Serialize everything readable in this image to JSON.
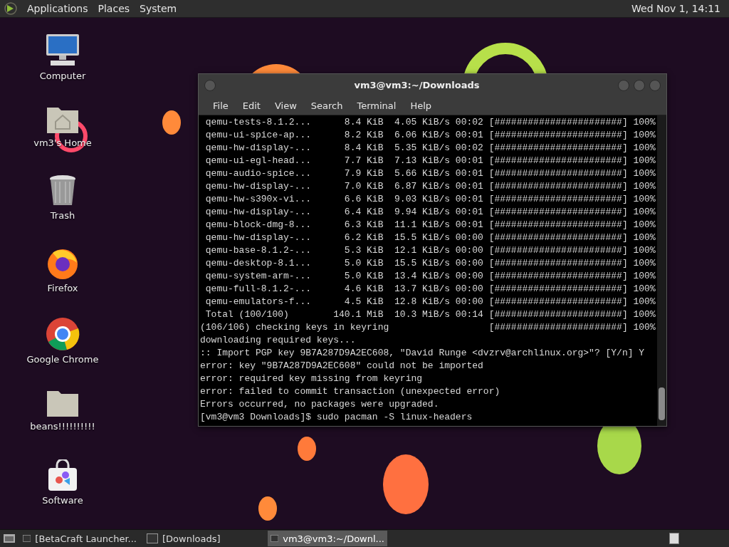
{
  "top_panel": {
    "menus": [
      "Applications",
      "Places",
      "System"
    ],
    "clock": "Wed Nov 1, 14:11"
  },
  "desktop_icons": [
    {
      "label": "Computer"
    },
    {
      "label": "vm3's Home"
    },
    {
      "label": "Trash"
    },
    {
      "label": "Firefox"
    },
    {
      "label": "Google Chrome"
    },
    {
      "label": "beans!!!!!!!!!!"
    },
    {
      "label": "Software"
    }
  ],
  "terminal": {
    "title": "vm3@vm3:~/Downloads",
    "menu": [
      "File",
      "Edit",
      "View",
      "Search",
      "Terminal",
      "Help"
    ],
    "lines": [
      " qemu-tests-8.1.2...      8.4 KiB  4.05 KiB/s 00:02 [#######################] 100%",
      " qemu-ui-spice-ap...      8.2 KiB  6.06 KiB/s 00:01 [#######################] 100%",
      " qemu-hw-display-...      8.4 KiB  5.35 KiB/s 00:02 [#######################] 100%",
      " qemu-ui-egl-head...      7.7 KiB  7.13 KiB/s 00:01 [#######################] 100%",
      " qemu-audio-spice...      7.9 KiB  5.66 KiB/s 00:01 [#######################] 100%",
      " qemu-hw-display-...      7.0 KiB  6.87 KiB/s 00:01 [#######################] 100%",
      " qemu-hw-s390x-vi...      6.6 KiB  9.03 KiB/s 00:01 [#######################] 100%",
      " qemu-hw-display-...      6.4 KiB  9.94 KiB/s 00:01 [#######################] 100%",
      " qemu-block-dmg-8...      6.3 KiB  11.1 KiB/s 00:01 [#######################] 100%",
      " qemu-hw-display-...      6.2 KiB  15.5 KiB/s 00:00 [#######################] 100%",
      " qemu-base-8.1.2-...      5.3 KiB  12.1 KiB/s 00:00 [#######################] 100%",
      " qemu-desktop-8.1...      5.0 KiB  15.5 KiB/s 00:00 [#######################] 100%",
      " qemu-system-arm-...      5.0 KiB  13.4 KiB/s 00:00 [#######################] 100%",
      " qemu-full-8.1.2-...      4.6 KiB  13.7 KiB/s 00:00 [#######################] 100%",
      " qemu-emulators-f...      4.5 KiB  12.8 KiB/s 00:00 [#######################] 100%",
      " Total (100/100)        140.1 MiB  10.3 MiB/s 00:14 [#######################] 100%",
      "(106/106) checking keys in keyring                  [#######################] 100%",
      "downloading required keys...",
      ":: Import PGP key 9B7A287D9A2EC608, \"David Runge <dvzrv@archlinux.org>\"? [Y/n] Y",
      "error: key \"9B7A287D9A2EC608\" could not be imported",
      "error: required key missing from keyring",
      "error: failed to commit transaction (unexpected error)",
      "Errors occurred, no packages were upgraded.",
      "[vm3@vm3 Downloads]$ sudo pacman -S linux-headers"
    ]
  },
  "taskbar": [
    {
      "label": "[BetaCraft Launcher...",
      "selected": false
    },
    {
      "label": "[Downloads]",
      "selected": false
    },
    {
      "label": "vm3@vm3:~/Downl...",
      "selected": true
    }
  ]
}
